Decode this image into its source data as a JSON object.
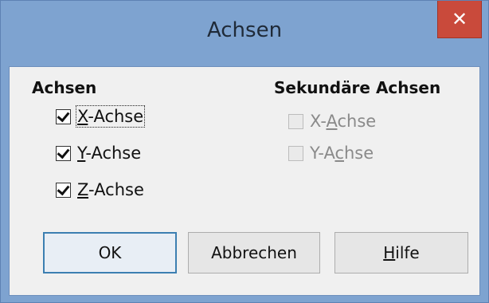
{
  "dialog": {
    "title": "Achsen",
    "close_glyph": "✕"
  },
  "primary_axes": {
    "heading": "Achsen",
    "items": [
      {
        "label_pre": "",
        "mnemonic": "X",
        "label_post": "-Achse",
        "checked": true,
        "enabled": true,
        "focused": true
      },
      {
        "label_pre": "",
        "mnemonic": "Y",
        "label_post": "-Achse",
        "checked": true,
        "enabled": true,
        "focused": false
      },
      {
        "label_pre": "",
        "mnemonic": "Z",
        "label_post": "-Achse",
        "checked": true,
        "enabled": true,
        "focused": false
      }
    ]
  },
  "secondary_axes": {
    "heading": "Sekundäre Achsen",
    "items": [
      {
        "label_pre": "X-",
        "mnemonic": "A",
        "label_post": "chse",
        "checked": false,
        "enabled": false
      },
      {
        "label_pre": "Y-A",
        "mnemonic": "c",
        "label_post": "hse",
        "checked": false,
        "enabled": false
      }
    ]
  },
  "buttons": {
    "ok": "OK",
    "cancel": "Abbrechen",
    "help_mnemonic": "H",
    "help_rest": "ilfe"
  },
  "colors": {
    "titlebar": "#7ea3d0",
    "close": "#c94a3b",
    "dialog_bg": "#f0f0f0",
    "default_button_border": "#3c7fb1"
  }
}
